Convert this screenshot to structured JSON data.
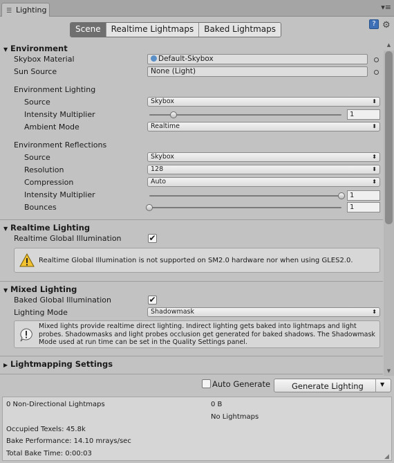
{
  "window": {
    "tab_title": "Lighting",
    "tab_icon": "lighting-icon",
    "menu_glyph": "⋮",
    "close_glyph": "▾≡"
  },
  "modes": [
    "Scene",
    "Realtime Lightmaps",
    "Baked Lightmaps"
  ],
  "active_mode": "Scene",
  "environment": {
    "header": "Environment",
    "skybox_label": "Skybox Material",
    "skybox_value": "Default-Skybox",
    "sun_label": "Sun Source",
    "sun_value": "None (Light)",
    "env_lighting_header": "Environment Lighting",
    "source_label": "Source",
    "source_value": "Skybox",
    "intensity_label": "Intensity Multiplier",
    "intensity_value": "1",
    "intensity_fraction": 0.125,
    "ambient_label": "Ambient Mode",
    "ambient_value": "Realtime",
    "env_reflections_header": "Environment Reflections",
    "refl_source_label": "Source",
    "refl_source_value": "Skybox",
    "resolution_label": "Resolution",
    "resolution_value": "128",
    "compression_label": "Compression",
    "compression_value": "Auto",
    "refl_intensity_label": "Intensity Multiplier",
    "refl_intensity_value": "1",
    "refl_intensity_fraction": 1.0,
    "bounces_label": "Bounces",
    "bounces_value": "1",
    "bounces_fraction": 0.0
  },
  "realtime": {
    "header": "Realtime Lighting",
    "gi_label": "Realtime Global Illumination",
    "gi_checked": true,
    "warning": "Realtime Global Illumination is not supported on SM2.0 hardware nor when using GLES2.0."
  },
  "mixed": {
    "header": "Mixed Lighting",
    "baked_gi_label": "Baked Global Illumination",
    "baked_gi_checked": true,
    "mode_label": "Lighting Mode",
    "mode_value": "Shadowmask",
    "info": "Mixed lights provide realtime direct lighting. Indirect lighting gets baked into lightmaps and light probes. Shadowmasks and light probes occlusion get generated for baked shadows. The Shadowmask Mode used at run time can be set in the Quality Settings panel."
  },
  "lightmapping": {
    "header": "Lightmapping Settings"
  },
  "generate": {
    "auto_label": "Auto Generate",
    "auto_checked": false,
    "button_label": "Generate Lighting"
  },
  "stats": {
    "lightmaps": "0 Non-Directional Lightmaps",
    "size": "0 B",
    "no_lightmaps": "No Lightmaps",
    "texels": "Occupied Texels: 45.8k",
    "performance": "Bake Performance: 14.10 mrays/sec",
    "time": "Total Bake Time: 0:00:03"
  },
  "colors": {
    "panel": "#c2c2c2",
    "active_tab": "#6f6f6f",
    "help_blue": "#3d6fb6",
    "warning_yellow": "#f2c230"
  }
}
